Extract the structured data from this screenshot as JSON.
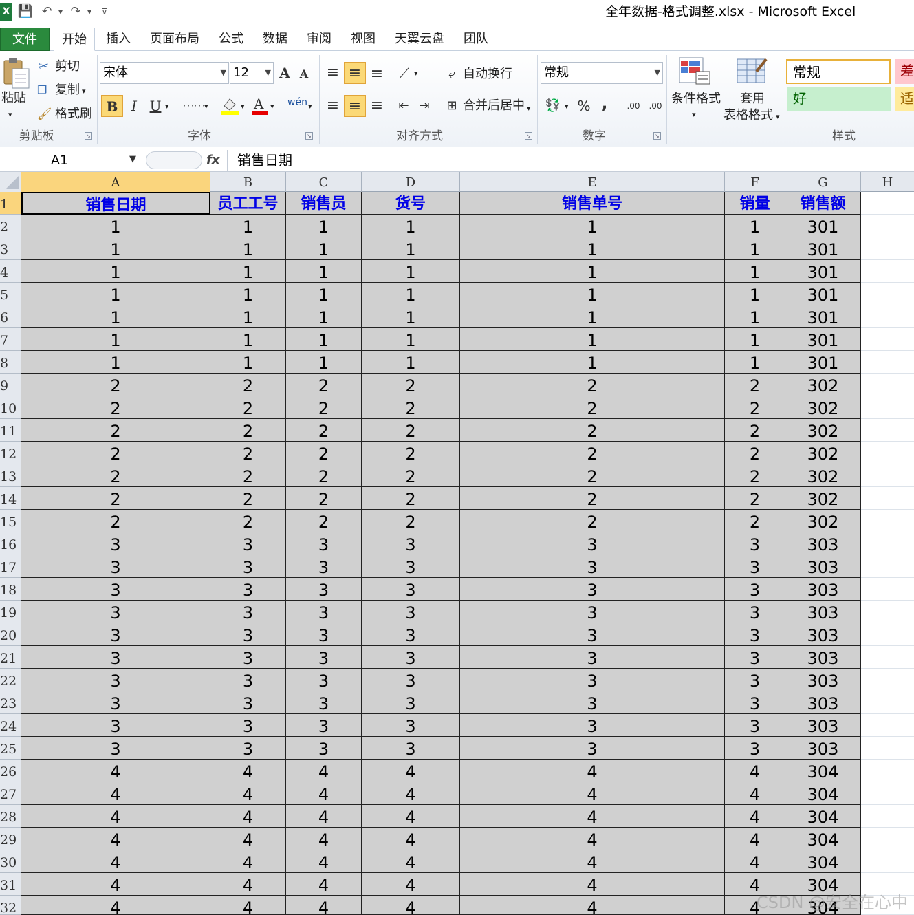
{
  "window": {
    "title": "全年数据-格式调整.xlsx - Microsoft Excel"
  },
  "quick_access": [
    {
      "name": "excel-logo-icon",
      "glyph": "X"
    },
    {
      "name": "save-icon",
      "glyph": "💾"
    },
    {
      "name": "undo-icon",
      "glyph": "↶"
    },
    {
      "name": "undo-dropdown-icon",
      "glyph": "▾"
    },
    {
      "name": "redo-icon",
      "glyph": "↷"
    },
    {
      "name": "redo-dropdown-icon",
      "glyph": "▾"
    },
    {
      "name": "customize-qat-icon",
      "glyph": "⊽"
    }
  ],
  "tabs": [
    "文件",
    "开始",
    "插入",
    "页面布局",
    "公式",
    "数据",
    "审阅",
    "视图",
    "天翼云盘",
    "团队"
  ],
  "ribbon": {
    "clipboard": {
      "paste": "粘贴",
      "cut": "剪切",
      "copy": "复制",
      "format_painter": "格式刷",
      "label": "剪贴板"
    },
    "font": {
      "name": "宋体",
      "size": "12",
      "bold": "B",
      "italic": "I",
      "underline": "U",
      "grow": "A",
      "shrink": "A",
      "phonetic": "wén",
      "label": "字体"
    },
    "alignment": {
      "wrap": "自动换行",
      "merge": "合并后居中",
      "label": "对齐方式"
    },
    "number": {
      "format": "常规",
      "percent": "%",
      "comma": ",",
      "inc_decimal": ".00",
      "dec_decimal": ".00",
      "label": "数字"
    },
    "styles": {
      "conditional": "条件格式",
      "table_1": "套用",
      "table_2": "表格格式",
      "normal": "常规",
      "bad": "差",
      "good": "好",
      "neutral": "适",
      "label": "样式"
    }
  },
  "formula_bar": {
    "name_box": "A1",
    "fx": "fx",
    "content": "销售日期"
  },
  "grid": {
    "columns": [
      "A",
      "B",
      "C",
      "D",
      "E",
      "F",
      "G",
      "H"
    ],
    "header_row": [
      "销售日期",
      "员工工号",
      "销售员",
      "货号",
      "销售单号",
      "销量",
      "销售额"
    ],
    "rows": [
      [
        "1",
        "1",
        "1",
        "1",
        "1",
        "1",
        "301"
      ],
      [
        "1",
        "1",
        "1",
        "1",
        "1",
        "1",
        "301"
      ],
      [
        "1",
        "1",
        "1",
        "1",
        "1",
        "1",
        "301"
      ],
      [
        "1",
        "1",
        "1",
        "1",
        "1",
        "1",
        "301"
      ],
      [
        "1",
        "1",
        "1",
        "1",
        "1",
        "1",
        "301"
      ],
      [
        "1",
        "1",
        "1",
        "1",
        "1",
        "1",
        "301"
      ],
      [
        "1",
        "1",
        "1",
        "1",
        "1",
        "1",
        "301"
      ],
      [
        "2",
        "2",
        "2",
        "2",
        "2",
        "2",
        "302"
      ],
      [
        "2",
        "2",
        "2",
        "2",
        "2",
        "2",
        "302"
      ],
      [
        "2",
        "2",
        "2",
        "2",
        "2",
        "2",
        "302"
      ],
      [
        "2",
        "2",
        "2",
        "2",
        "2",
        "2",
        "302"
      ],
      [
        "2",
        "2",
        "2",
        "2",
        "2",
        "2",
        "302"
      ],
      [
        "2",
        "2",
        "2",
        "2",
        "2",
        "2",
        "302"
      ],
      [
        "2",
        "2",
        "2",
        "2",
        "2",
        "2",
        "302"
      ],
      [
        "3",
        "3",
        "3",
        "3",
        "3",
        "3",
        "303"
      ],
      [
        "3",
        "3",
        "3",
        "3",
        "3",
        "3",
        "303"
      ],
      [
        "3",
        "3",
        "3",
        "3",
        "3",
        "3",
        "303"
      ],
      [
        "3",
        "3",
        "3",
        "3",
        "3",
        "3",
        "303"
      ],
      [
        "3",
        "3",
        "3",
        "3",
        "3",
        "3",
        "303"
      ],
      [
        "3",
        "3",
        "3",
        "3",
        "3",
        "3",
        "303"
      ],
      [
        "3",
        "3",
        "3",
        "3",
        "3",
        "3",
        "303"
      ],
      [
        "3",
        "3",
        "3",
        "3",
        "3",
        "3",
        "303"
      ],
      [
        "3",
        "3",
        "3",
        "3",
        "3",
        "3",
        "303"
      ],
      [
        "3",
        "3",
        "3",
        "3",
        "3",
        "3",
        "303"
      ],
      [
        "4",
        "4",
        "4",
        "4",
        "4",
        "4",
        "304"
      ],
      [
        "4",
        "4",
        "4",
        "4",
        "4",
        "4",
        "304"
      ],
      [
        "4",
        "4",
        "4",
        "4",
        "4",
        "4",
        "304"
      ],
      [
        "4",
        "4",
        "4",
        "4",
        "4",
        "4",
        "304"
      ],
      [
        "4",
        "4",
        "4",
        "4",
        "4",
        "4",
        "304"
      ],
      [
        "4",
        "4",
        "4",
        "4",
        "4",
        "4",
        "304"
      ],
      [
        "4",
        "4",
        "4",
        "4",
        "4",
        "4",
        "304"
      ]
    ],
    "selected_cell": "A1"
  },
  "watermark": "CSDN @安全在心中"
}
